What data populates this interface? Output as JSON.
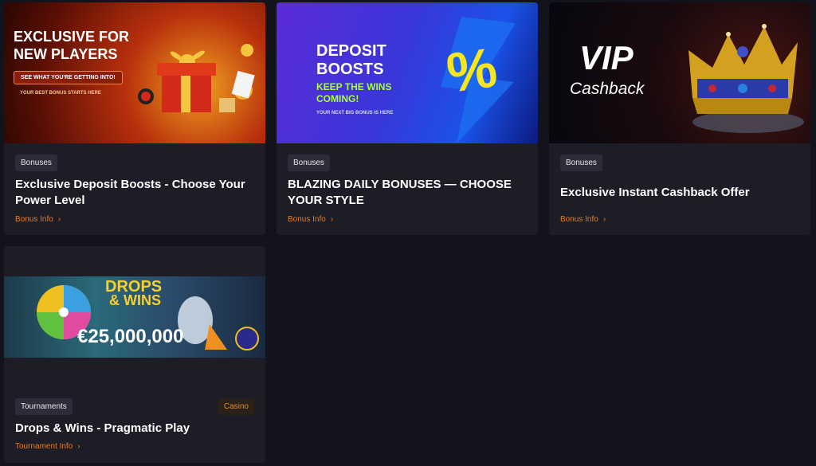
{
  "cards": [
    {
      "tag": "Bonuses",
      "title": "Exclusive Deposit Boosts - Choose Your Power Level",
      "link": "Bonus Info",
      "banner": {
        "headline1": "EXCLUSIVE FOR",
        "headline2": "NEW PLAYERS",
        "cta": "SEE WHAT YOU'RE GETTING INTO!",
        "sub": "YOUR BEST BONUS STARTS HERE"
      }
    },
    {
      "tag": "Bonuses",
      "title": "BLAZING DAILY BONUSES — CHOOSE YOUR STYLE",
      "link": "Bonus Info",
      "banner": {
        "headline1": "DEPOSIT",
        "headline2": "BOOSTS",
        "sub1": "KEEP THE WINS",
        "sub2": "COMING!",
        "sub3": "YOUR NEXT BIG BONUS IS HERE",
        "symbol": "%"
      }
    },
    {
      "tag": "Bonuses",
      "title": "Exclusive Instant Cashback Offer",
      "link": "Bonus Info",
      "banner": {
        "headline1": "VIP",
        "headline2": "Cashback"
      }
    },
    {
      "tag": "Tournaments",
      "tag_right": "Casino",
      "title": "Drops & Wins - Pragmatic Play",
      "link": "Tournament Info",
      "banner": {
        "headline1": "DROPS",
        "headline2": "& WINS",
        "prize": "€25,000,000"
      }
    }
  ]
}
